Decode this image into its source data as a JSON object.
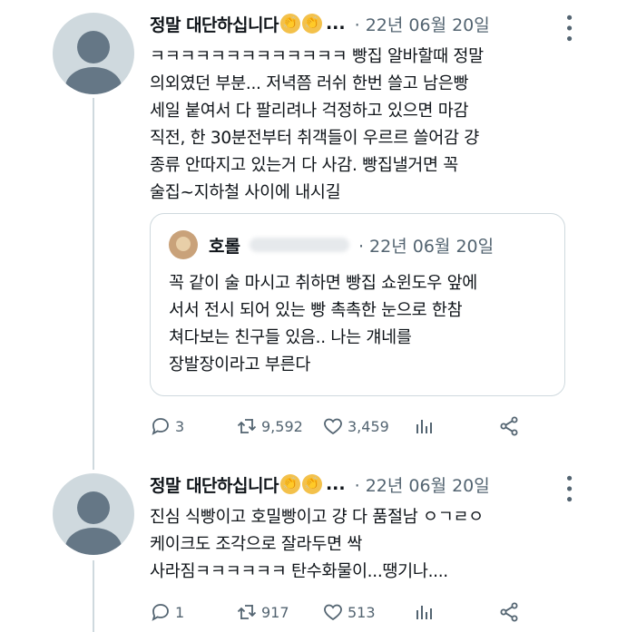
{
  "tweets": [
    {
      "author": "정말 대단하십니다",
      "emoji": [
        "👏",
        "👏"
      ],
      "ellipsis": "...",
      "date": "· 22년 06월 20일",
      "more_icon": "more-dots-icon",
      "lines": [
        "ㅋㅋㅋㅋㅋㅋㅋㅋㅋㅋㅋㅋㅋ 빵집 알바할때 정말",
        "의외였던 부분... 저녁쯤 러쉬 한번 쓸고 남은빵",
        "세일 붙여서 다 팔리려나 걱정하고 있으면 마감",
        "직전, 한 30분전부터 취객들이 우르르 쓸어감 걍",
        "종류 안따지고 있는거 다 사감. 빵집낼거면 꼭",
        "술집~지하철 사이에 내시길"
      ],
      "quote": {
        "author": "호롤",
        "date": "· 22년 06월 20일",
        "lines": [
          "꼭 같이 술 마시고 취하면 빵집 쇼윈도우 앞에",
          "서서 전시 되어 있는 빵 촉촉한 눈으로 한참",
          "쳐다보는 친구들 있음.. 나는 걔네를",
          "장발장이라고 부른다"
        ]
      },
      "actions": {
        "replies": "3",
        "retweets": "9,592",
        "likes": "3,459"
      }
    },
    {
      "author": "정말 대단하십니다",
      "emoji": [
        "👏",
        "👏"
      ],
      "ellipsis": "...",
      "date": "· 22년 06월 20일",
      "more_icon": "more-dots-icon",
      "lines": [
        "진심 식빵이고 호밀빵이고 걍 다 품절남 ㅇㄱㄹㅇ",
        "케이크도 조각으로 잘라두면 싹",
        "사라짐ㅋㅋㅋㅋㅋㅋ 탄수화물이...땡기나...."
      ],
      "actions": {
        "replies": "1",
        "retweets": "917",
        "likes": "513"
      }
    }
  ]
}
